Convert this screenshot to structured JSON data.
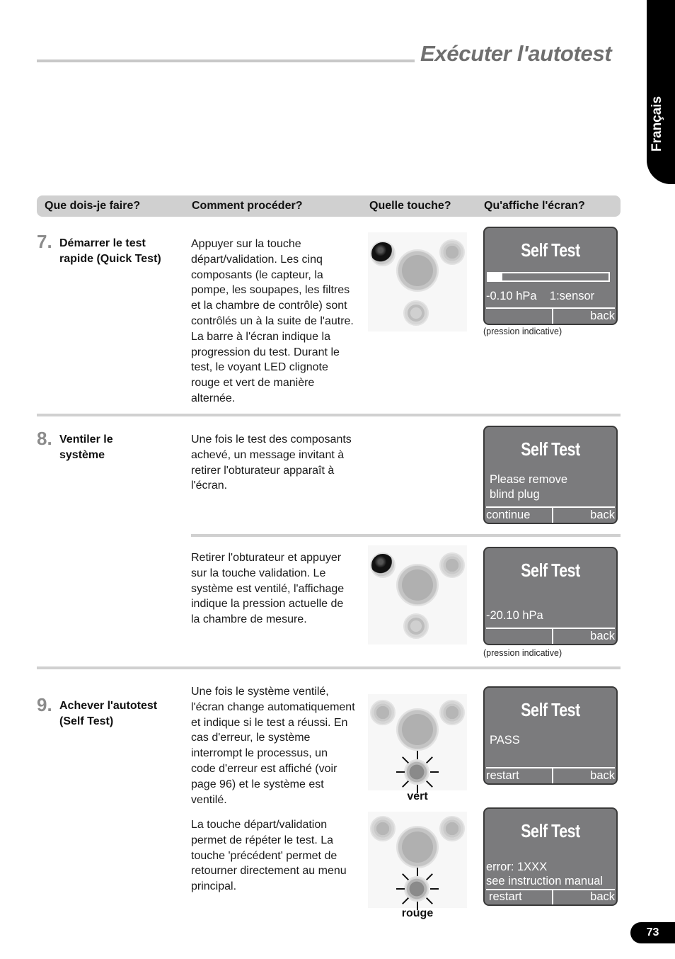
{
  "page": {
    "title": "Exécuter l'autotest",
    "language_tab": "Français",
    "page_number": "73"
  },
  "table_header": {
    "col1": "Que dois-je faire?",
    "col2": "Comment procéder?",
    "col3": "Quelle touche?",
    "col4": "Qu'affiche l'écran?"
  },
  "steps": [
    {
      "number": "7.",
      "title": "Démarrer le test rapide (Quick Test)",
      "description": "Appuyer sur la touche départ/validation. Les cinq composants (le capteur, la pompe, les soupapes, les filtres et la chambre de contrôle) sont contrôlés un à la suite de l'autre. La barre à l'écran indique la progres­sion du test.  Durant le test, le voyant LED clignote rouge et vert de manière alternée.",
      "screen": {
        "title": "Self Test",
        "progress_percent": 12,
        "line1": "-0.10 hPa    1:sensor",
        "soft_left": "",
        "soft_right": "back"
      },
      "note": "(pression indicative)"
    },
    {
      "number": "8.",
      "title": "Ventiler le système",
      "description": "Une fois le test des compo­sants achevé, un message invitant à retirer l'obturateur apparaît à l'écran.",
      "screen": {
        "title": "Self Test",
        "line1": "Please remove",
        "line2": "blind plug",
        "soft_left": "continue",
        "soft_right": "back"
      }
    },
    {
      "description": "Retirer l'obturateur et ap­puyer sur la touche valida­tion. Le système est ventilé, l'affichage indique la pres­sion actuelle de la chambre de mesure.",
      "screen": {
        "title": "Self Test",
        "line1": "-20.10 hPa",
        "soft_left": "",
        "soft_right": "back"
      },
      "note": "(pression indicative)"
    },
    {
      "number": "9.",
      "title": "Achever l'autotest (Self Test)",
      "description": "Une fois le système ventilé, l'écran change automati­quement et indique si le test a réussi. En cas d'erreur, le système interrompt le processus, un code d'erreur est affiché (voir page 96) et le système est ventilé.",
      "led_caption": "vert",
      "screen": {
        "title": "Self Test",
        "line1": "PASS",
        "soft_left": "restart",
        "soft_right": "back"
      }
    },
    {
      "description": "La touche départ/validation permet de répéter le test. La touche 'précédent' permet de retourner directement au menu principal.",
      "led_caption": "rouge",
      "screen": {
        "title": "Self Test",
        "line1": "error: 1XXX",
        "line2": "see instruction manual",
        "soft_left": "restart",
        "soft_right": "back"
      }
    }
  ]
}
